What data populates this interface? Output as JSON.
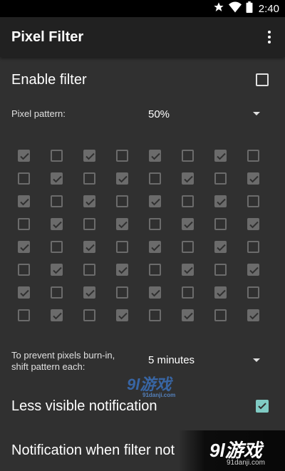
{
  "status_bar": {
    "time": "2:40",
    "icons": [
      "star-icon",
      "wifi-icon",
      "battery-icon"
    ]
  },
  "app_bar": {
    "title": "Pixel Filter",
    "menu_icon": "overflow-menu-icon"
  },
  "settings": {
    "enable_filter": {
      "label": "Enable filter",
      "checked": false
    },
    "pixel_pattern": {
      "label": "Pixel pattern:",
      "value": "50%"
    },
    "shift_interval": {
      "label_line1": "To prevent pixels burn-in,",
      "label_line2": "shift pattern each:",
      "value": "5 minutes"
    },
    "less_visible_notification": {
      "label": "Less visible notification",
      "checked": true
    },
    "notification_when_filter": {
      "label": "Notification when filter not"
    }
  },
  "pattern_grid": [
    [
      1,
      0,
      1,
      0,
      1,
      0,
      1,
      0
    ],
    [
      0,
      1,
      0,
      1,
      0,
      1,
      0,
      1
    ],
    [
      1,
      0,
      1,
      0,
      1,
      0,
      1,
      0
    ],
    [
      0,
      1,
      0,
      1,
      0,
      1,
      0,
      1
    ],
    [
      1,
      0,
      1,
      0,
      1,
      0,
      1,
      0
    ],
    [
      0,
      1,
      0,
      1,
      0,
      1,
      0,
      1
    ],
    [
      1,
      0,
      1,
      0,
      1,
      0,
      1,
      0
    ],
    [
      0,
      1,
      0,
      1,
      0,
      1,
      0,
      1
    ]
  ],
  "watermarks": {
    "mid_logo": "9l游戏",
    "mid_url": "91danji.com",
    "corner_logo": "9l游戏",
    "corner_url": "91danji.com"
  },
  "colors": {
    "background": "#303030",
    "app_bar": "#212121",
    "accent": "#80cbc4",
    "grid_box": "#6b6b6b"
  }
}
